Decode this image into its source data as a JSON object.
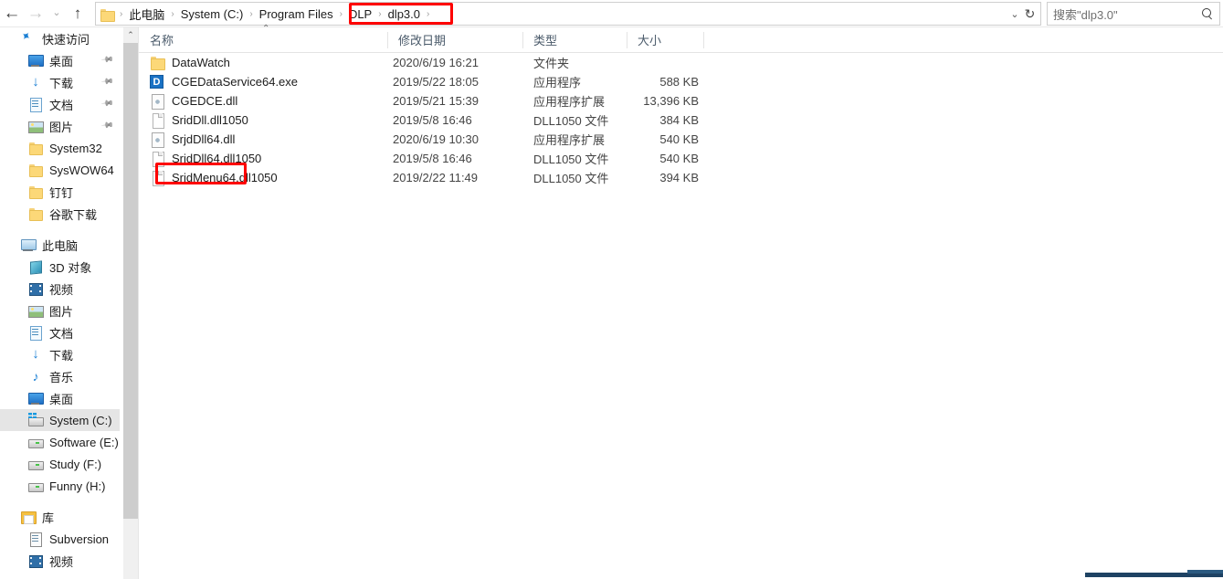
{
  "window": {
    "title": "dlp3.0"
  },
  "nav": {
    "back_icon": "←",
    "forward_icon": "→",
    "recent_icon": "⌄",
    "up_icon": "↑",
    "back_name": "back",
    "forward_name": "forward",
    "recent_name": "recent-locations",
    "up_name": "up-one-level"
  },
  "address": {
    "folder_icon": "folder-icon",
    "crumbs": [
      "此电脑",
      "System (C:)",
      "Program Files",
      "DLP",
      "dlp3.0"
    ],
    "separator": "›",
    "dropdown_icon": "⌄",
    "refresh_icon": "↻",
    "highlight_color": "#fe0000"
  },
  "search": {
    "placeholder": "搜索\"dlp3.0\"",
    "icon": "search-icon"
  },
  "sidebar": {
    "sections": [
      {
        "name": "quick-access",
        "label": "快速访问",
        "icon": "pin-star-icon",
        "indent": 0,
        "items": [
          {
            "label": "桌面",
            "icon": "desktop-icon",
            "pinned": true,
            "indent": 1
          },
          {
            "label": "下载",
            "icon": "download-icon",
            "pinned": true,
            "indent": 1
          },
          {
            "label": "文档",
            "icon": "document-icon",
            "pinned": true,
            "indent": 1
          },
          {
            "label": "图片",
            "icon": "pictures-icon",
            "pinned": true,
            "indent": 1
          },
          {
            "label": "System32",
            "icon": "folder-icon",
            "pinned": false,
            "indent": 1
          },
          {
            "label": "SysWOW64",
            "icon": "folder-icon",
            "pinned": false,
            "indent": 1
          },
          {
            "label": "钉钉",
            "icon": "folder-icon",
            "pinned": false,
            "indent": 1
          },
          {
            "label": "谷歌下载",
            "icon": "folder-icon",
            "pinned": false,
            "indent": 1
          }
        ]
      },
      {
        "name": "this-pc",
        "label": "此电脑",
        "icon": "this-pc-icon",
        "indent": 0,
        "items": [
          {
            "label": "3D 对象",
            "icon": "3d-objects-icon",
            "pinned": false,
            "indent": 1
          },
          {
            "label": "视频",
            "icon": "videos-icon",
            "pinned": false,
            "indent": 1
          },
          {
            "label": "图片",
            "icon": "pictures-icon",
            "pinned": false,
            "indent": 1
          },
          {
            "label": "文档",
            "icon": "document-icon",
            "pinned": false,
            "indent": 1
          },
          {
            "label": "下载",
            "icon": "download-icon",
            "pinned": false,
            "indent": 1
          },
          {
            "label": "音乐",
            "icon": "music-icon",
            "pinned": false,
            "indent": 1
          },
          {
            "label": "桌面",
            "icon": "desktop-icon",
            "pinned": false,
            "indent": 1
          },
          {
            "label": "System (C:)",
            "icon": "system-drive-icon",
            "pinned": false,
            "indent": 1,
            "selected": true
          },
          {
            "label": "Software (E:)",
            "icon": "drive-icon",
            "pinned": false,
            "indent": 1
          },
          {
            "label": "Study (F:)",
            "icon": "drive-icon",
            "pinned": false,
            "indent": 1
          },
          {
            "label": "Funny (H:)",
            "icon": "drive-icon",
            "pinned": false,
            "indent": 1
          }
        ]
      },
      {
        "name": "libraries",
        "label": "库",
        "icon": "library-icon",
        "indent": 0,
        "items": [
          {
            "label": "Subversion",
            "icon": "subversion-icon",
            "pinned": false,
            "indent": 1
          },
          {
            "label": "视频",
            "icon": "videos-icon",
            "pinned": false,
            "indent": 1
          }
        ]
      }
    ],
    "scrollbar": {
      "up_icon": "⌃"
    }
  },
  "filelist": {
    "columns": [
      {
        "label": "名称",
        "name": "column-name"
      },
      {
        "label": "修改日期",
        "name": "column-date-modified"
      },
      {
        "label": "类型",
        "name": "column-type"
      },
      {
        "label": "大小",
        "name": "column-size"
      }
    ],
    "sort_caret": "⌃",
    "rows": [
      {
        "name": "DataWatch",
        "date": "2020/6/19 16:21",
        "type": "文件夹",
        "size": "",
        "icon": "folder-icon"
      },
      {
        "name": "CGEDataService64.exe",
        "date": "2019/5/22 18:05",
        "type": "应用程序",
        "size": "588 KB",
        "icon": "app-icon",
        "icon_letter": "D"
      },
      {
        "name": "CGEDCE.dll",
        "date": "2019/5/21 15:39",
        "type": "应用程序扩展",
        "size": "13,396 KB",
        "icon": "dll-icon"
      },
      {
        "name": "SridDll.dll1050",
        "date": "2019/5/8 16:46",
        "type": "DLL1050 文件",
        "size": "384 KB",
        "icon": "file-icon"
      },
      {
        "name": "SrjdDll64.dll",
        "date": "2020/6/19 10:30",
        "type": "应用程序扩展",
        "size": "540 KB",
        "icon": "dll-icon",
        "highlighted": true
      },
      {
        "name": "SrjdDll64.dll1050",
        "date": "2019/5/8 16:46",
        "type": "DLL1050 文件",
        "size": "540 KB",
        "icon": "file-icon"
      },
      {
        "name": "SrjdMenu64.dll1050",
        "date": "2019/2/22 11:49",
        "type": "DLL1050 文件",
        "size": "394 KB",
        "icon": "file-icon"
      }
    ],
    "highlight_color": "#fe0000"
  }
}
